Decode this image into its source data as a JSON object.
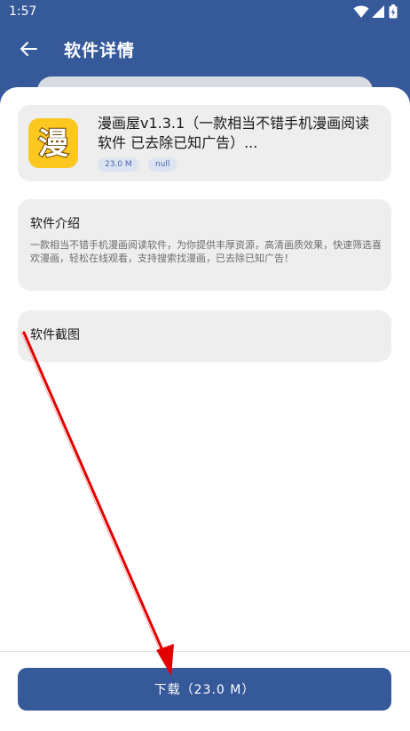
{
  "status_bar": {
    "time": "1:57"
  },
  "header": {
    "title": "软件详情",
    "back_icon": "arrow-left-icon"
  },
  "app": {
    "icon_text": "漫",
    "name": "漫画屋v1.3.1（一款相当不错手机漫画阅读软件 已去除已知广告）...",
    "size_tag": "23.0 M",
    "version_tag": "null",
    "icon_color": "#fcc71f"
  },
  "intro": {
    "title": "软件介绍",
    "text": "一款相当不错手机漫画阅读软件，为你提供丰厚资源，高清画质效果，快速筛选喜欢漫画，轻松在线观看，支持搜索找漫画，已去除已知广告！"
  },
  "screenshots": {
    "title": "软件截图"
  },
  "download": {
    "label": "下载（23.0 M）"
  },
  "colors": {
    "primary": "#36599a",
    "card": "#eeeeee",
    "annotation_arrow": "#e30000"
  }
}
